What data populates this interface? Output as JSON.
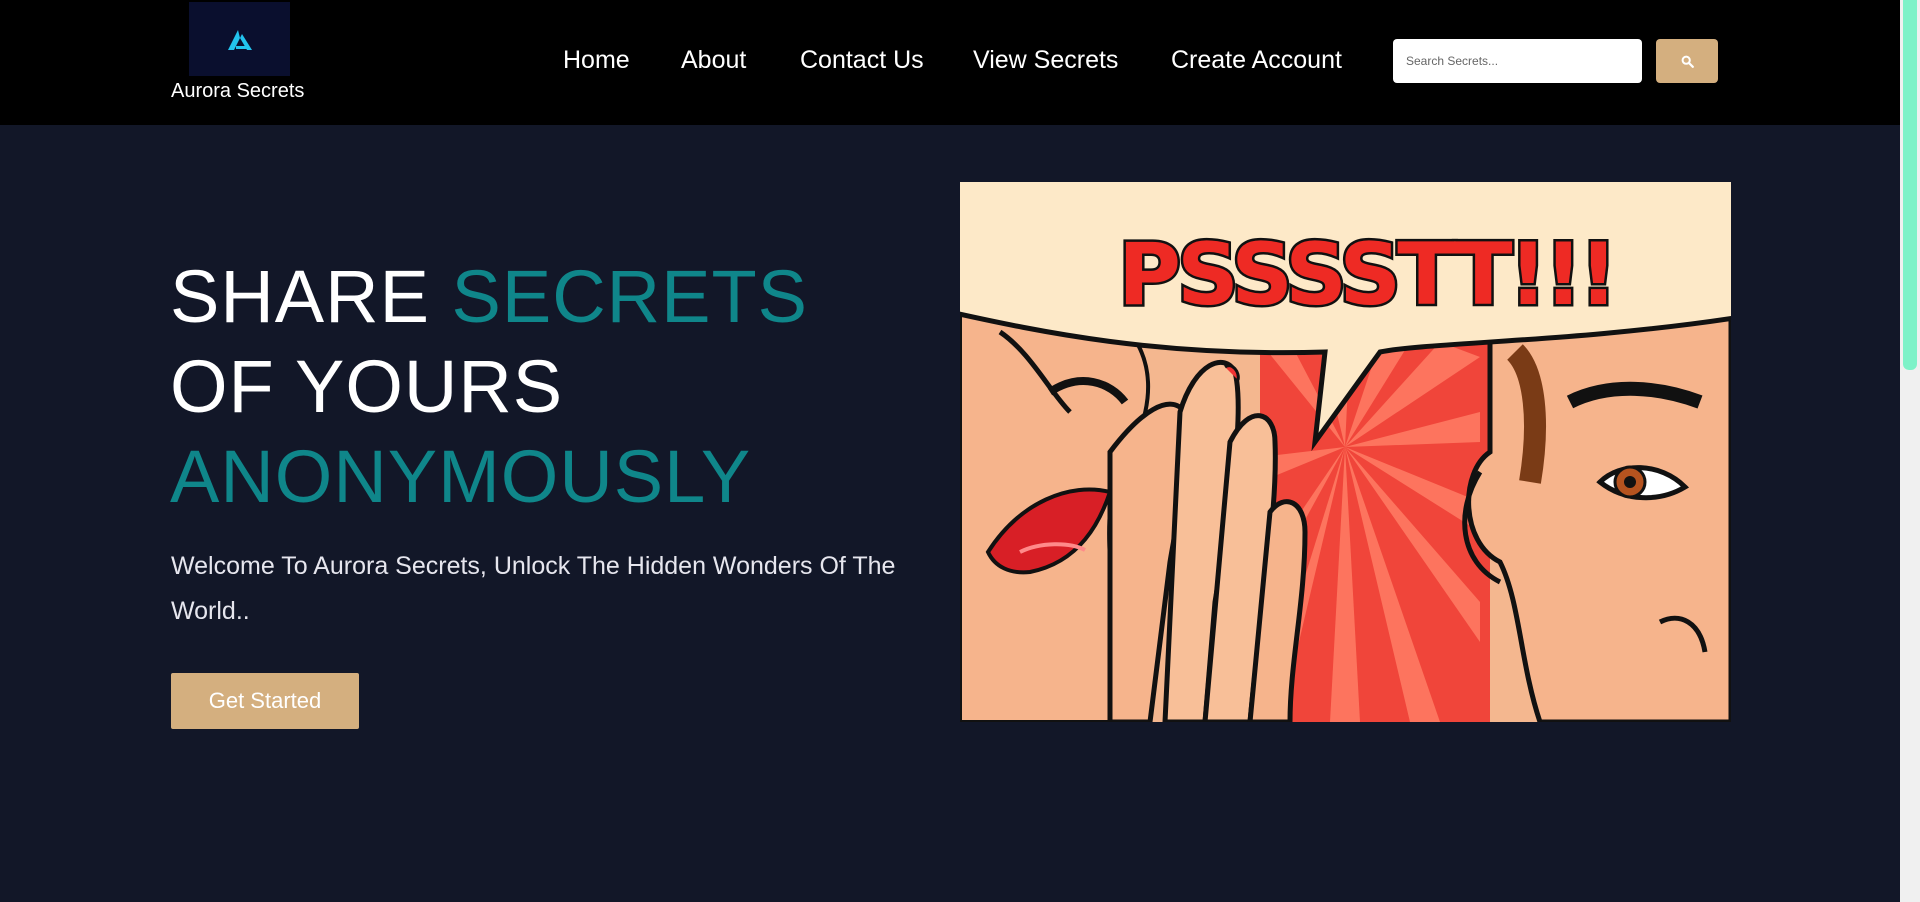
{
  "brand": {
    "name": "Aurora Secrets",
    "logo_icon": "aurora-logo-icon"
  },
  "nav": {
    "items": [
      {
        "label": "Home"
      },
      {
        "label": "About"
      },
      {
        "label": "Contact Us"
      },
      {
        "label": "View Secrets"
      },
      {
        "label": "Create Account"
      }
    ]
  },
  "search": {
    "placeholder": "Search Secrets...",
    "value": "",
    "button_icon": "search-icon"
  },
  "hero": {
    "title_part1": "SHARE ",
    "title_highlight1": "SECRETS",
    "title_part2": " OF YOURS ",
    "title_highlight2": "ANONYMOUSLY",
    "subtitle": "Welcome To Aurora Secrets, Unlock The Hidden Wonders Of The World..",
    "cta_label": "Get Started",
    "illustration_text": "PSSSSTT!!!"
  },
  "colors": {
    "navbar_bg": "#000000",
    "page_bg": "#121728",
    "accent_teal": "#0f868a",
    "button_tan": "#d4af7f",
    "scrollbar_thumb": "#7ef2c8"
  }
}
